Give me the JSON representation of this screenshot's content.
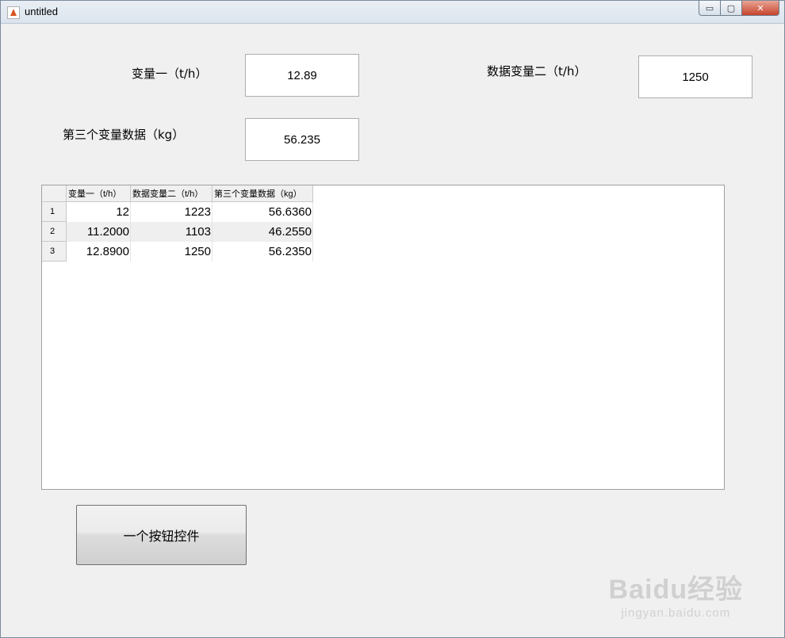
{
  "window": {
    "title": "untitled",
    "controls": {
      "minimize": "▭",
      "maximize": "▢",
      "close": "✕"
    }
  },
  "fields": {
    "var1_label": "变量一（t/h）",
    "var1_value": "12.89",
    "var2_label": "数据变量二（t/h）",
    "var2_value": "1250",
    "var3_label": "第三个变量数据（kg）",
    "var3_value": "56.235"
  },
  "table": {
    "columns": [
      "变量一（t/h）",
      "数据变量二（t/h）",
      "第三个变量数据（kg）"
    ],
    "rows": [
      {
        "index": "1",
        "cells": [
          "12",
          "1223",
          "56.6360"
        ]
      },
      {
        "index": "2",
        "cells": [
          "11.2000",
          "1103",
          "46.2550"
        ]
      },
      {
        "index": "3",
        "cells": [
          "12.8900",
          "1250",
          "56.2350"
        ]
      }
    ]
  },
  "button": {
    "label": "一个按钮控件"
  },
  "watermark": {
    "logo": "Baidu经验",
    "sub": "jingyan.baidu.com"
  }
}
